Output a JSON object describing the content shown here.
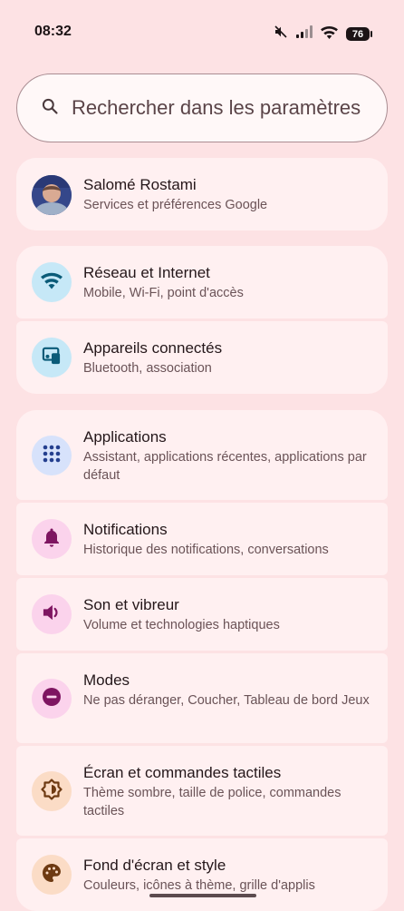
{
  "status_bar": {
    "time": "08:32",
    "battery": "76"
  },
  "search": {
    "placeholder": "Rechercher dans les paramètres"
  },
  "account": {
    "name": "Salomé Rostami",
    "subtitle": "Services et préférences Google"
  },
  "settings": [
    {
      "title": "Réseau et Internet",
      "subtitle": "Mobile, Wi-Fi, point d'accès",
      "icon": "wifi-icon",
      "color": "#c6e8f7",
      "fg": "#0a5b78"
    },
    {
      "title": "Appareils connectés",
      "subtitle": "Bluetooth, association",
      "icon": "connected-devices-icon",
      "color": "#c6e8f7",
      "fg": "#0a5b78"
    },
    {
      "title": "Applications",
      "subtitle": "Assistant, applications récentes, applications par défaut",
      "icon": "apps-grid-icon",
      "color": "#d7e2fb",
      "fg": "#243f8f"
    },
    {
      "title": "Notifications",
      "subtitle": "Historique des notifications, conversations",
      "icon": "bell-icon",
      "color": "#fbd3ec",
      "fg": "#7e1561"
    },
    {
      "title": "Son et vibreur",
      "subtitle": "Volume et technologies haptiques",
      "icon": "volume-icon",
      "color": "#fbd3ec",
      "fg": "#7e1561"
    },
    {
      "title": "Modes",
      "subtitle": "Ne pas déranger, Coucher, Tableau de bord Jeux",
      "icon": "do-not-disturb-icon",
      "color": "#fbd3ec",
      "fg": "#7e1561"
    },
    {
      "title": "Écran et commandes tactiles",
      "subtitle": "Thème sombre, taille de police, commandes tactiles",
      "icon": "brightness-icon",
      "color": "#fbdcc6",
      "fg": "#6e3a12"
    },
    {
      "title": "Fond d'écran et style",
      "subtitle": "Couleurs, icônes à thème, grille d'applis",
      "icon": "palette-icon",
      "color": "#fbdcc6",
      "fg": "#6e3a12"
    }
  ]
}
